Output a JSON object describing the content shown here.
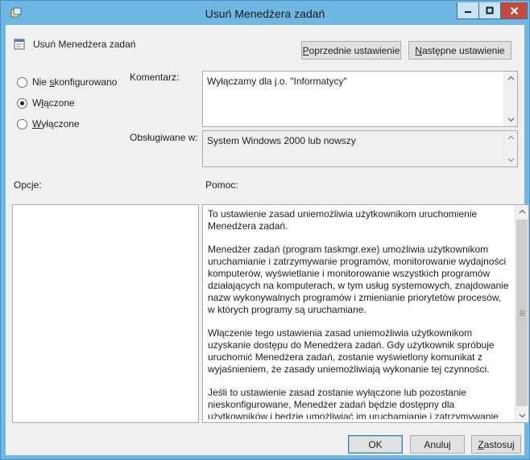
{
  "window": {
    "title": "Usuń Menedżera zadań"
  },
  "header": {
    "setting_name": "Usuń Menedżera zadań",
    "prev_button": "Poprzednie ustawienie",
    "next_button": "Następne ustawienie"
  },
  "state": {
    "options": [
      {
        "label": "Nie skonfigurowano",
        "checked": false
      },
      {
        "label": "Włączone",
        "checked": true
      },
      {
        "label": "Wyłączone",
        "checked": false
      }
    ]
  },
  "comment": {
    "label": "Komentarz:",
    "value": "Wyłączamy dla j.o. \"Informatycy\""
  },
  "supported": {
    "label": "Obsługiwane w:",
    "value": "System Windows 2000 lub nowszy"
  },
  "options_section": {
    "label": "Opcje:"
  },
  "help": {
    "label": "Pomoc:",
    "paragraphs": [
      "To ustawienie zasad uniemożliwia użytkownikom uruchomienie Menedżera zadań.",
      "Menedżer zadań (program taskmgr.exe) umożliwia użytkownikom uruchamianie i zatrzymywanie programów, monitorowanie wydajności komputerów, wyświetlanie i monitorowanie wszystkich programów działających na komputerach, w tym usług systemowych, znajdowanie nazw wykonywalnych programów i zmienianie priorytetów procesów, w których programy są uruchamiane.",
      "Włączenie tego ustawienia zasad uniemożliwia użytkownikom uzyskanie dostępu do Menedżera zadań. Gdy użytkownik spróbuje uruchomić Menedżera zadań, zostanie wyświetlony komunikat z wyjaśnieniem, że zasady uniemożliwiają wykonanie tej czynności.",
      "Jeśli to ustawienie zasad zostanie wyłączone lub pozostanie nieskonfigurowane, Menedżer zadań będzie dostępny dla użytkowników i będzie umożliwiać im uruchamianie i zatrzymywanie programów,"
    ]
  },
  "footer": {
    "ok": "OK",
    "cancel": "Anuluj",
    "apply": "Zastosuj"
  },
  "colors": {
    "titlebar": "#6fb7e3",
    "close_button": "#c54a3d",
    "dialog_background": "#f0f0f0"
  }
}
